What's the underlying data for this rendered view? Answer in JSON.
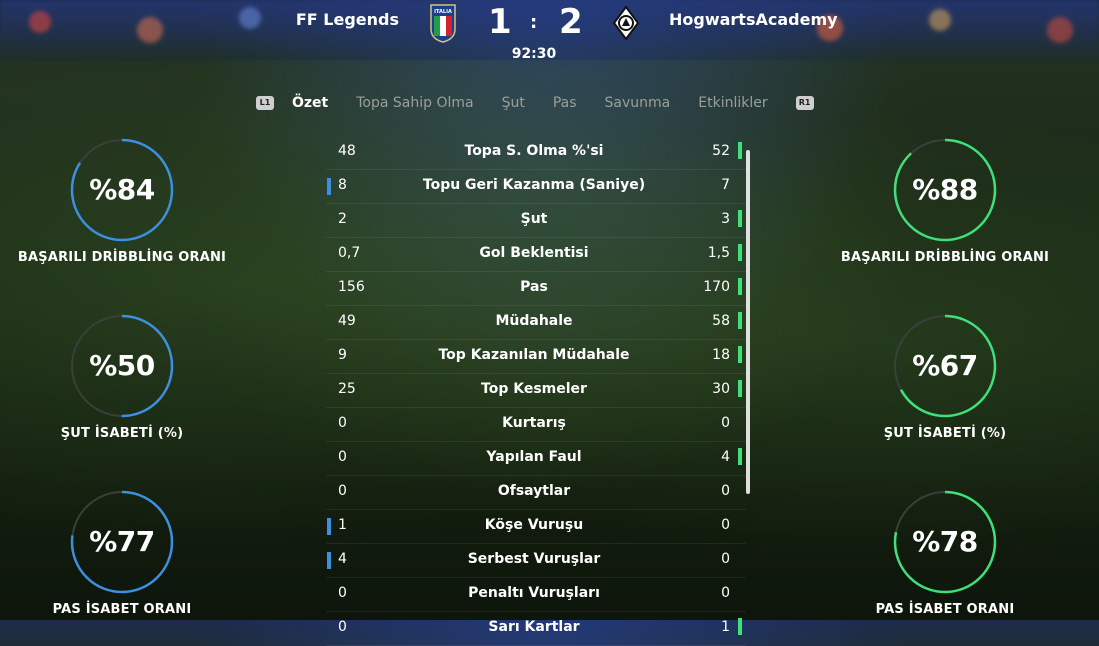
{
  "match": {
    "home_team": "FF Legends",
    "away_team": "HogwartsAcademy",
    "home_score": "1",
    "away_score": "2",
    "separator": ":",
    "clock": "92:30",
    "home_crest_text": "ITALIA",
    "away_crest_icon": "borussia-crest-icon"
  },
  "tabs": {
    "left_button": "L1",
    "right_button": "R1",
    "items": [
      "Özet",
      "Topa Sahip Olma",
      "Şut",
      "Pas",
      "Savunma",
      "Etkinlikler"
    ],
    "active": "Özet"
  },
  "colors": {
    "home_accent": "#3d8fe0",
    "away_accent": "#3fe07a",
    "ring_track": "#3a3f3a"
  },
  "home_rings": [
    {
      "value": "%84",
      "label": "BAŞARILI DRİBBLİNG ORANI",
      "fraction": 0.84
    },
    {
      "value": "%50",
      "label": "ŞUT İSABETİ (%)",
      "fraction": 0.5
    },
    {
      "value": "%77",
      "label": "PAS İSABET ORANI",
      "fraction": 0.77
    }
  ],
  "away_rings": [
    {
      "value": "%88",
      "label": "BAŞARILI DRİBBLİNG ORANI",
      "fraction": 0.88
    },
    {
      "value": "%67",
      "label": "ŞUT İSABETİ (%)",
      "fraction": 0.67
    },
    {
      "value": "%78",
      "label": "PAS İSABET ORANI",
      "fraction": 0.78
    }
  ],
  "stats": [
    {
      "label": "Topa S. Olma %'si",
      "home": "48",
      "away": "52",
      "leader": "away"
    },
    {
      "label": "Topu Geri Kazanma (Saniye)",
      "home": "8",
      "away": "7",
      "leader": "home"
    },
    {
      "label": "Şut",
      "home": "2",
      "away": "3",
      "leader": "away"
    },
    {
      "label": "Gol Beklentisi",
      "home": "0,7",
      "away": "1,5",
      "leader": "away"
    },
    {
      "label": "Pas",
      "home": "156",
      "away": "170",
      "leader": "away"
    },
    {
      "label": "Müdahale",
      "home": "49",
      "away": "58",
      "leader": "away"
    },
    {
      "label": "Top Kazanılan Müdahale",
      "home": "9",
      "away": "18",
      "leader": "away"
    },
    {
      "label": "Top Kesmeler",
      "home": "25",
      "away": "30",
      "leader": "away"
    },
    {
      "label": "Kurtarış",
      "home": "0",
      "away": "0",
      "leader": "none"
    },
    {
      "label": "Yapılan Faul",
      "home": "0",
      "away": "4",
      "leader": "away"
    },
    {
      "label": "Ofsaytlar",
      "home": "0",
      "away": "0",
      "leader": "none"
    },
    {
      "label": "Köşe Vuruşu",
      "home": "1",
      "away": "0",
      "leader": "home"
    },
    {
      "label": "Serbest Vuruşlar",
      "home": "4",
      "away": "0",
      "leader": "home"
    },
    {
      "label": "Penaltı Vuruşları",
      "home": "0",
      "away": "0",
      "leader": "none"
    },
    {
      "label": "Sarı Kartlar",
      "home": "0",
      "away": "1",
      "leader": "away"
    }
  ]
}
